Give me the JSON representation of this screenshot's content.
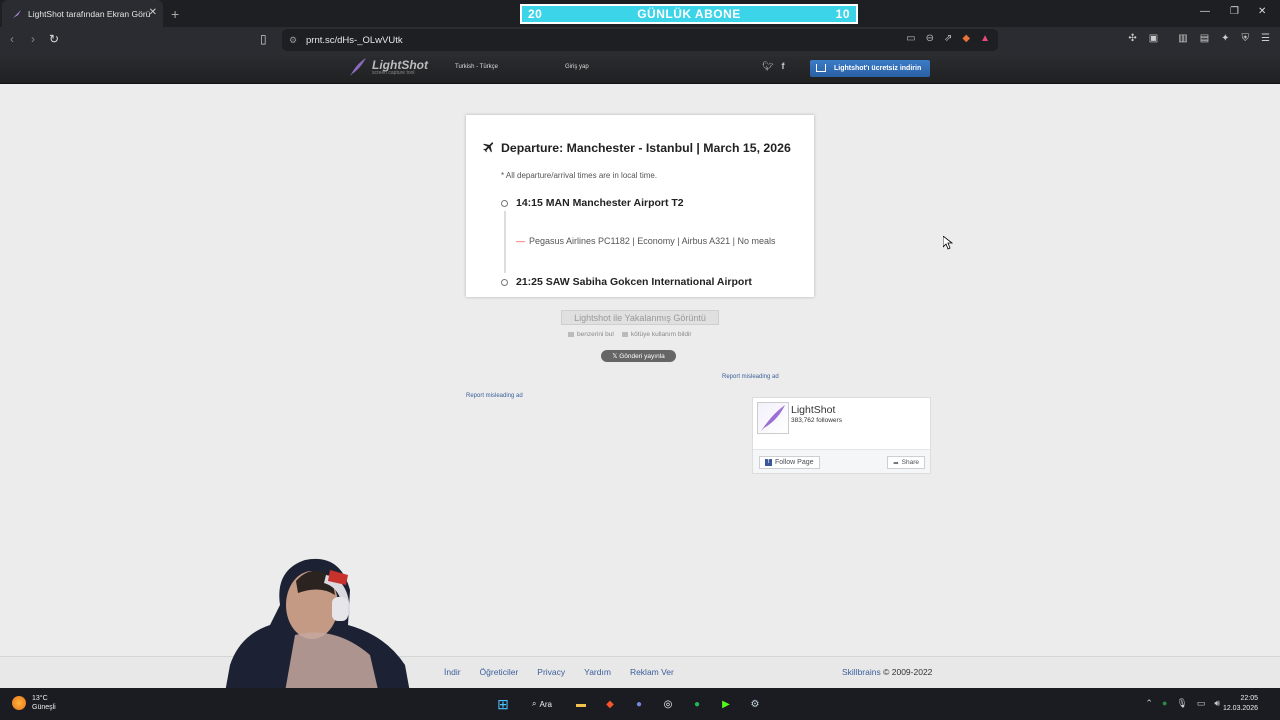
{
  "browser": {
    "tab_title": "LightShot tarafından Ekran Görü",
    "new_tab": "+",
    "url": "prnt.sc/dHs-_OLwVUtk"
  },
  "overlay": {
    "left_count": "20",
    "label": "GÜNLÜK ABONE",
    "right_count": "10"
  },
  "lightshot": {
    "logo": "LightShot",
    "logo_tagline": "screen capture tool",
    "language": "Turkish - Türkçe",
    "login": "Giriş yap",
    "download_label": "Lightshot'ı ücretsiz indirin"
  },
  "screenshot_card": {
    "title": "Departure: Manchester - Istanbul | March 15, 2026",
    "note": "* All departure/arrival times are in local time.",
    "departure": "14:15  MAN Manchester Airport T2",
    "flight_info": "Pegasus Airlines PC1182 | Economy | Airbus A321 | No meals",
    "arrival": "21:25  SAW Sabiha Gokcen International Airport"
  },
  "actions": {
    "captured_label": "Lightshot ile Yakalanmış Görüntü",
    "find_similar": "benzerini bul",
    "report_abuse": "kötüye kullanım bildir",
    "post_button": "𝕏 Gönderi yayınla",
    "report_ad_right": "Report misleading ad",
    "report_ad_left": "Report misleading ad"
  },
  "facebook": {
    "name": "LightShot",
    "followers": "383,762 followers",
    "follow": "Follow Page",
    "share": "Share"
  },
  "footer": {
    "links": [
      "İndir",
      "Öğreticiler",
      "Privacy",
      "Yardım",
      "Reklam Ver"
    ],
    "company": "Skillbrains",
    "copyright": "© 2009-2022"
  },
  "taskbar": {
    "temperature": "13°C",
    "weather": "Güneşli",
    "search": "Ara",
    "time": "22:05",
    "date": "12.03.2026"
  },
  "colors": {
    "accent": "#3bd4e8",
    "link": "#3b5f9b",
    "download": "#2a5fa3"
  }
}
